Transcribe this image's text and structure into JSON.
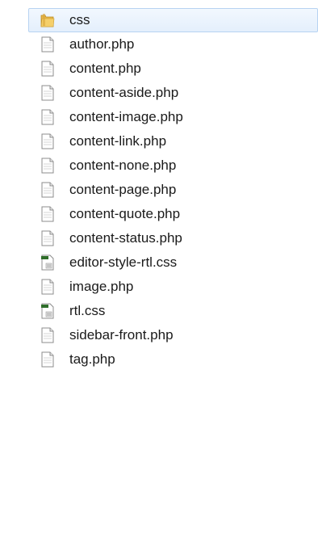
{
  "files": [
    {
      "label": "css",
      "icon": "folder-icon",
      "selected": true
    },
    {
      "label": "author.php",
      "icon": "document-icon"
    },
    {
      "label": "content.php",
      "icon": "document-icon"
    },
    {
      "label": "content-aside.php",
      "icon": "document-icon"
    },
    {
      "label": "content-image.php",
      "icon": "document-icon"
    },
    {
      "label": "content-link.php",
      "icon": "document-icon"
    },
    {
      "label": "content-none.php",
      "icon": "document-icon"
    },
    {
      "label": "content-page.php",
      "icon": "document-icon"
    },
    {
      "label": "content-quote.php",
      "icon": "document-icon"
    },
    {
      "label": "content-status.php",
      "icon": "document-icon"
    },
    {
      "label": "editor-style-rtl.css",
      "icon": "css-file-icon"
    },
    {
      "label": "image.php",
      "icon": "document-icon"
    },
    {
      "label": "rtl.css",
      "icon": "css-file-icon"
    },
    {
      "label": "sidebar-front.php",
      "icon": "document-icon"
    },
    {
      "label": "tag.php",
      "icon": "document-icon"
    }
  ],
  "colors": {
    "folder": "#e8b84a",
    "selection_border": "#b7d3f2",
    "css_icon_green": "#2f6e2a"
  }
}
